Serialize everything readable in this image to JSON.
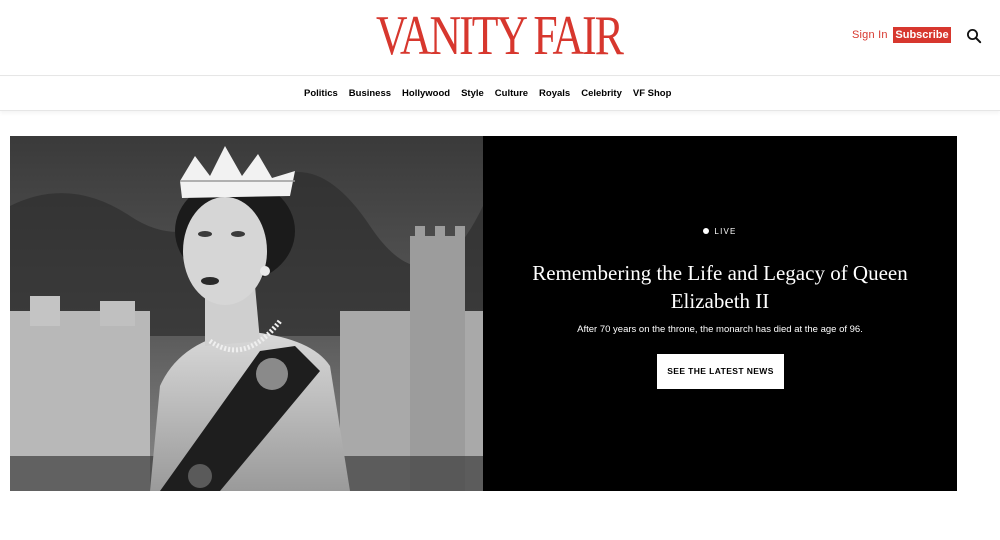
{
  "header": {
    "logo": "VANITY FAIR",
    "sign_in": "Sign In",
    "subscribe": "Subscribe",
    "search_icon": "search-icon",
    "brand_color": "#d7372e"
  },
  "nav": {
    "items": [
      {
        "label": "Politics"
      },
      {
        "label": "Business"
      },
      {
        "label": "Hollywood"
      },
      {
        "label": "Style"
      },
      {
        "label": "Culture"
      },
      {
        "label": "Royals"
      },
      {
        "label": "Celebrity"
      },
      {
        "label": "VF Shop"
      }
    ]
  },
  "hero": {
    "live_label": "LIVE",
    "headline": "Remembering the Life and Legacy of Queen Elizabeth II",
    "dek": "After 70 years on the throne, the monarch has died at the age of 96.",
    "cta": "SEE THE LATEST NEWS",
    "panel_color": "#000000"
  }
}
